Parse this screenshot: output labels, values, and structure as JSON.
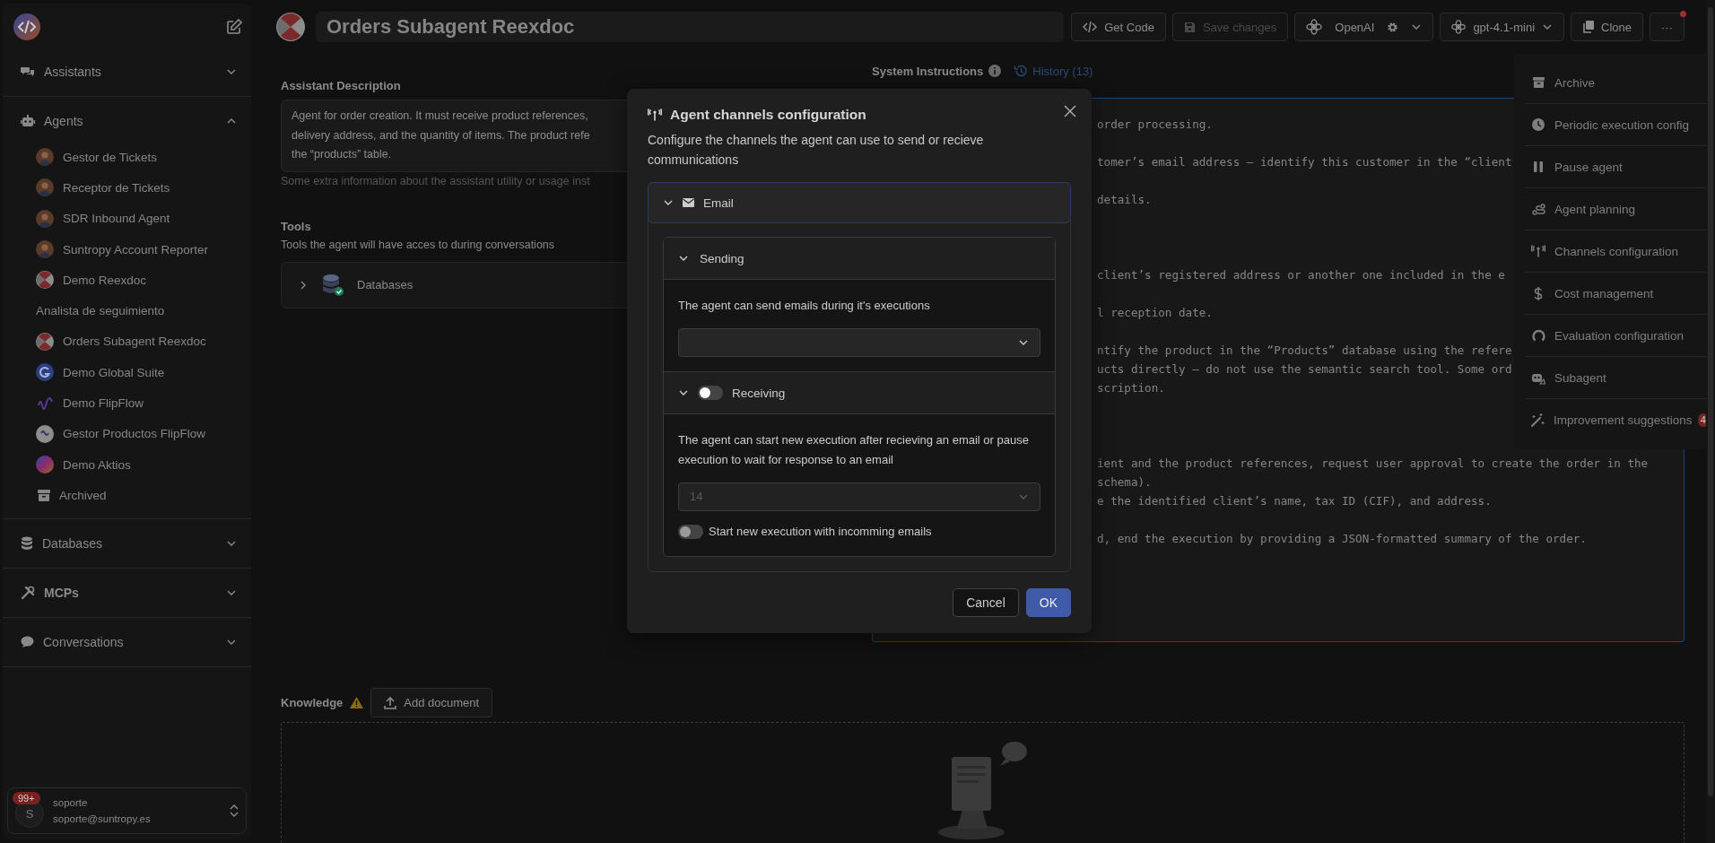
{
  "sidebar": {
    "sections": [
      {
        "label": "Assistants",
        "expanded": false
      },
      {
        "label": "Agents",
        "expanded": true,
        "items": [
          {
            "label": "Gestor de Tickets"
          },
          {
            "label": "Receptor de Tickets"
          },
          {
            "label": "SDR Inbound Agent"
          },
          {
            "label": "Suntropy Account Reporter"
          },
          {
            "label": "Demo Reexdoc"
          },
          {
            "label": "Analista de seguimiento"
          },
          {
            "label": "Orders Subagent Reexdoc"
          },
          {
            "label": "Demo Global Suite"
          },
          {
            "label": "Demo FlipFlow"
          },
          {
            "label": "Gestor Productos FlipFlow"
          },
          {
            "label": "Demo Aktios"
          },
          {
            "label": "Archived"
          }
        ]
      },
      {
        "label": "Databases",
        "expanded": false
      },
      {
        "label": "MCPs",
        "expanded": false
      },
      {
        "label": "Conversations",
        "expanded": false
      }
    ],
    "user": {
      "initial": "S",
      "badge": "99+",
      "name": "soporte",
      "email": "soporte@suntropy.es"
    }
  },
  "header": {
    "title": "Orders Subagent Reexdoc",
    "buttons": [
      {
        "label": "Get Code",
        "disabled": false
      },
      {
        "label": "Save changes",
        "disabled": true
      },
      {
        "label": "OpenAI",
        "disabled": false
      },
      {
        "label": "gpt-4.1-mini",
        "disabled": false
      },
      {
        "label": "Clone",
        "disabled": false
      },
      {
        "label": "···",
        "disabled": false,
        "notification": true
      }
    ]
  },
  "description": {
    "label": "Assistant Description",
    "lines": [
      "Agent for order creation. It must receive product references,",
      "delivery address, and the quantity of items. The product refe",
      "the “products” table."
    ],
    "hint": "Some extra information about the assistant utility or usage inst"
  },
  "tools": {
    "title": "Tools",
    "subtitle": "Tools the agent will have acces to during conversations",
    "items": [
      {
        "label": "Databases",
        "expanded": false
      }
    ]
  },
  "system_instructions": {
    "title": "System Instructions",
    "history": "History (13)",
    "blocks": [
      [
        "order processing."
      ],
      [
        "tomer’s email address — identify this customer in the “client"
      ],
      [
        "details."
      ],
      [
        "client’s registered address or another one included in the e"
      ],
      [
        "l reception date."
      ],
      [
        "ntify the product in the “Products” database using the refere",
        "ucts directly — do not use the semantic search tool. Some ord",
        "scription."
      ],
      [
        "ient and the product references, request user approval to create the order in the",
        "schema).",
        "e the identified client’s name, tax ID (CIF), and address."
      ],
      [
        "d, end the execution by providing a JSON-formatted summary of the order."
      ]
    ]
  },
  "knowledge": {
    "title": "Knowledge",
    "button": "Add document"
  },
  "more_menu": {
    "items": [
      {
        "label": "Archive"
      },
      {
        "label": "Periodic execution config"
      },
      {
        "label": "Pause agent"
      },
      {
        "label": "Agent planning"
      },
      {
        "label": "Channels configuration"
      },
      {
        "label": "Cost management"
      },
      {
        "label": "Evaluation configuration"
      },
      {
        "label": "Subagent"
      },
      {
        "label": "Improvement suggestions",
        "badge": "4"
      }
    ]
  },
  "dialog": {
    "title": "Agent channels configuration",
    "description": "Configure the channels the agent can use to send or recieve communications",
    "channels": [
      {
        "label": "Email",
        "expanded": true,
        "sections": [
          {
            "kind": "plain",
            "label": "Sending",
            "expanded": true,
            "text": "The agent can send emails during it's executions",
            "select": {
              "disabled": false
            }
          },
          {
            "kind": "toggle",
            "label": "Receiving",
            "expanded": true,
            "on": false,
            "text": "The agent can start new execution after recieving an email or pause execution to wait for response to an email",
            "select": {
              "value": "14",
              "disabled": true
            },
            "option": {
              "label": "Start new execution with incomming emails",
              "on": false
            }
          }
        ]
      }
    ],
    "buttons": [
      {
        "label": "Cancel",
        "primary": false
      },
      {
        "label": "OK",
        "primary": true
      }
    ]
  }
}
